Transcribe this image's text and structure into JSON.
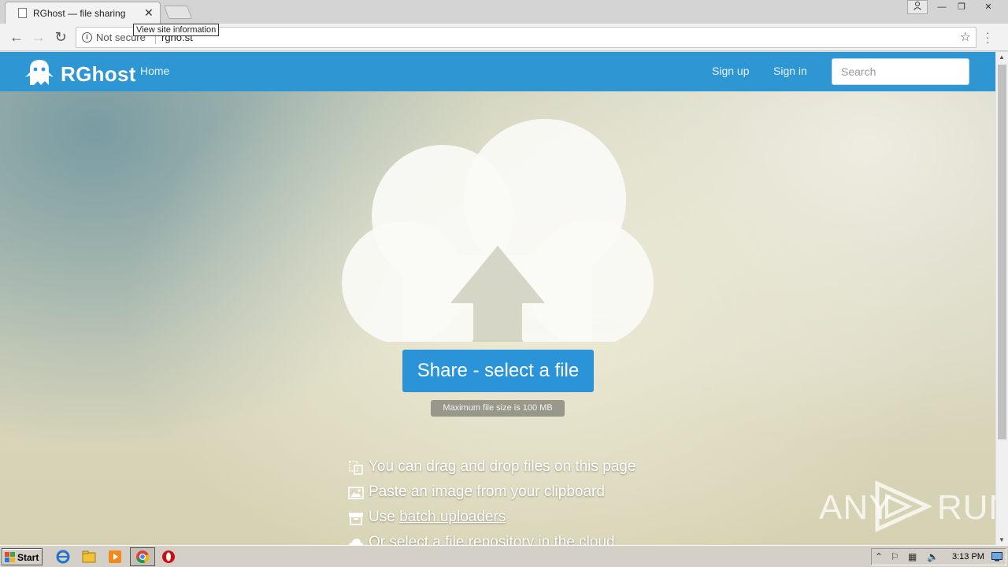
{
  "browser": {
    "tab_title": "RGhost — file sharing",
    "tab_close": "✕",
    "tooltip": "View site information",
    "security_label": "Not secure",
    "url": "rgho.st",
    "window_min": "—",
    "window_max": "❐",
    "window_close": "✕"
  },
  "site": {
    "brand": "RGhost",
    "nav": {
      "home": "Home",
      "signup": "Sign up",
      "signin": "Sign in"
    },
    "search_placeholder": "Search",
    "share_button": "Share - select a file",
    "max_size": "Maximum file size is 100 MB",
    "tips": {
      "drag": "You can drag and drop files on this page",
      "paste": "Paste an image from your clipboard",
      "batch_prefix": "Use ",
      "batch_link": "batch uploaders",
      "cloud": "Or select a file repository in the cloud"
    }
  },
  "watermark": {
    "left": "ANY",
    "right": "RUN"
  },
  "taskbar": {
    "start": "Start",
    "clock": "3:13 PM"
  },
  "colors": {
    "navbar": "#2d96d3",
    "share_button": "#2b94d8"
  }
}
